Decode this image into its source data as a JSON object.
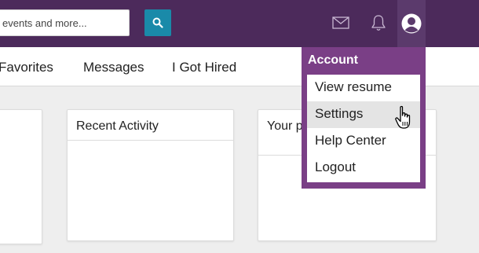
{
  "header": {
    "search_value": "events and more...",
    "search_icon": "search-icon",
    "nav_icons": [
      "mail-icon",
      "bell-icon",
      "user-avatar-icon"
    ]
  },
  "subnav": {
    "items": [
      {
        "label": "Favorites"
      },
      {
        "label": "Messages"
      },
      {
        "label": "I Got Hired"
      }
    ]
  },
  "cards": [
    {
      "title": ""
    },
    {
      "title": "Recent Activity"
    },
    {
      "title": "Your p"
    }
  ],
  "account_menu": {
    "heading": "Account",
    "items": [
      {
        "label": "View resume"
      },
      {
        "label": "Settings",
        "hovered": true
      },
      {
        "label": "Help Center"
      },
      {
        "label": "Logout"
      }
    ]
  },
  "colors": {
    "topbar": "#4c2a5b",
    "menu": "#7a3f86",
    "search_button": "#1a8aa9"
  }
}
